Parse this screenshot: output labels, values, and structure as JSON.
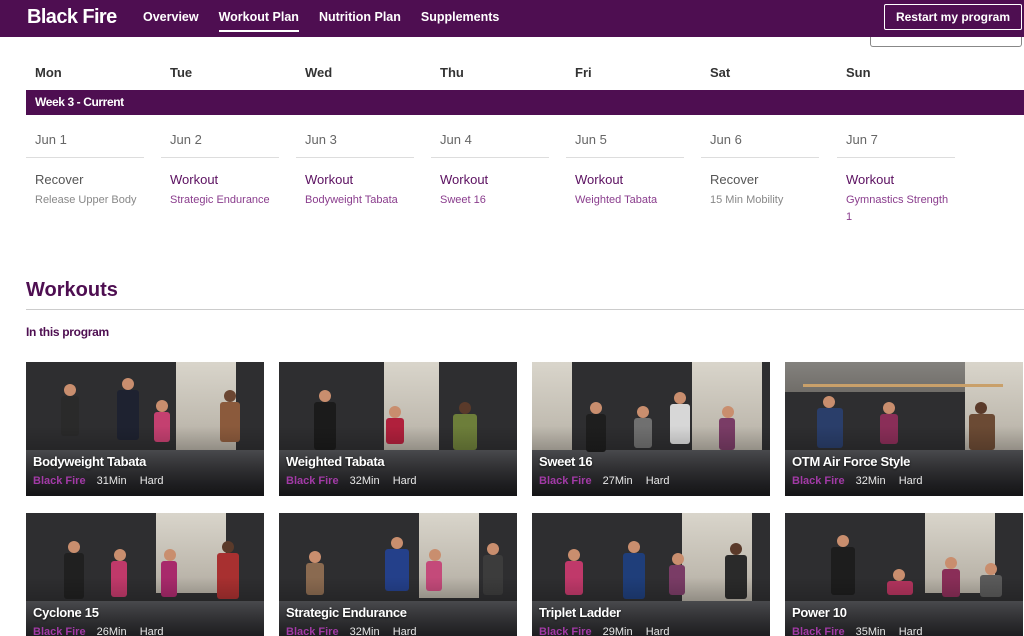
{
  "app": {
    "logo": "Black Fire"
  },
  "nav": {
    "items": [
      {
        "label": "Overview",
        "active": false
      },
      {
        "label": "Workout Plan",
        "active": true
      },
      {
        "label": "Nutrition Plan",
        "active": false
      },
      {
        "label": "Supplements",
        "active": false
      }
    ],
    "restart_label": "Restart my program"
  },
  "calendar": {
    "day_labels": [
      "Mon",
      "Tue",
      "Wed",
      "Thu",
      "Fri",
      "Sat",
      "Sun"
    ],
    "week_label": "Week 3 - Current",
    "days": [
      {
        "date": "Jun 1",
        "type": "Recover",
        "name": "Release Upper Body"
      },
      {
        "date": "Jun 2",
        "type": "Workout",
        "name": "Strategic Endurance"
      },
      {
        "date": "Jun 3",
        "type": "Workout",
        "name": "Bodyweight Tabata"
      },
      {
        "date": "Jun 4",
        "type": "Workout",
        "name": "Sweet 16"
      },
      {
        "date": "Jun 5",
        "type": "Workout",
        "name": "Weighted Tabata"
      },
      {
        "date": "Jun 6",
        "type": "Recover",
        "name": "15 Min Mobility"
      },
      {
        "date": "Jun 7",
        "type": "Workout",
        "name": "Gymnastics Strength 1"
      }
    ]
  },
  "workouts": {
    "title": "Workouts",
    "subtitle": "In this program",
    "cards": [
      {
        "title": "Bodyweight Tabata",
        "brand": "Black Fire",
        "duration": "31Min",
        "level": "Hard"
      },
      {
        "title": "Weighted Tabata",
        "brand": "Black Fire",
        "duration": "32Min",
        "level": "Hard"
      },
      {
        "title": "Sweet 16",
        "brand": "Black Fire",
        "duration": "27Min",
        "level": "Hard"
      },
      {
        "title": "OTM Air Force Style",
        "brand": "Black Fire",
        "duration": "32Min",
        "level": "Hard"
      },
      {
        "title": "Cyclone 15",
        "brand": "Black Fire",
        "duration": "26Min",
        "level": "Hard"
      },
      {
        "title": "Strategic Endurance",
        "brand": "Black Fire",
        "duration": "32Min",
        "level": "Hard"
      },
      {
        "title": "Triplet Ladder",
        "brand": "Black Fire",
        "duration": "29Min",
        "level": "Hard"
      },
      {
        "title": "Power 10",
        "brand": "Black Fire",
        "duration": "35Min",
        "level": "Hard"
      }
    ]
  },
  "colors": {
    "brand": "#4e0e51",
    "accent": "#a23aa6",
    "workout_text": "#5b1060"
  }
}
